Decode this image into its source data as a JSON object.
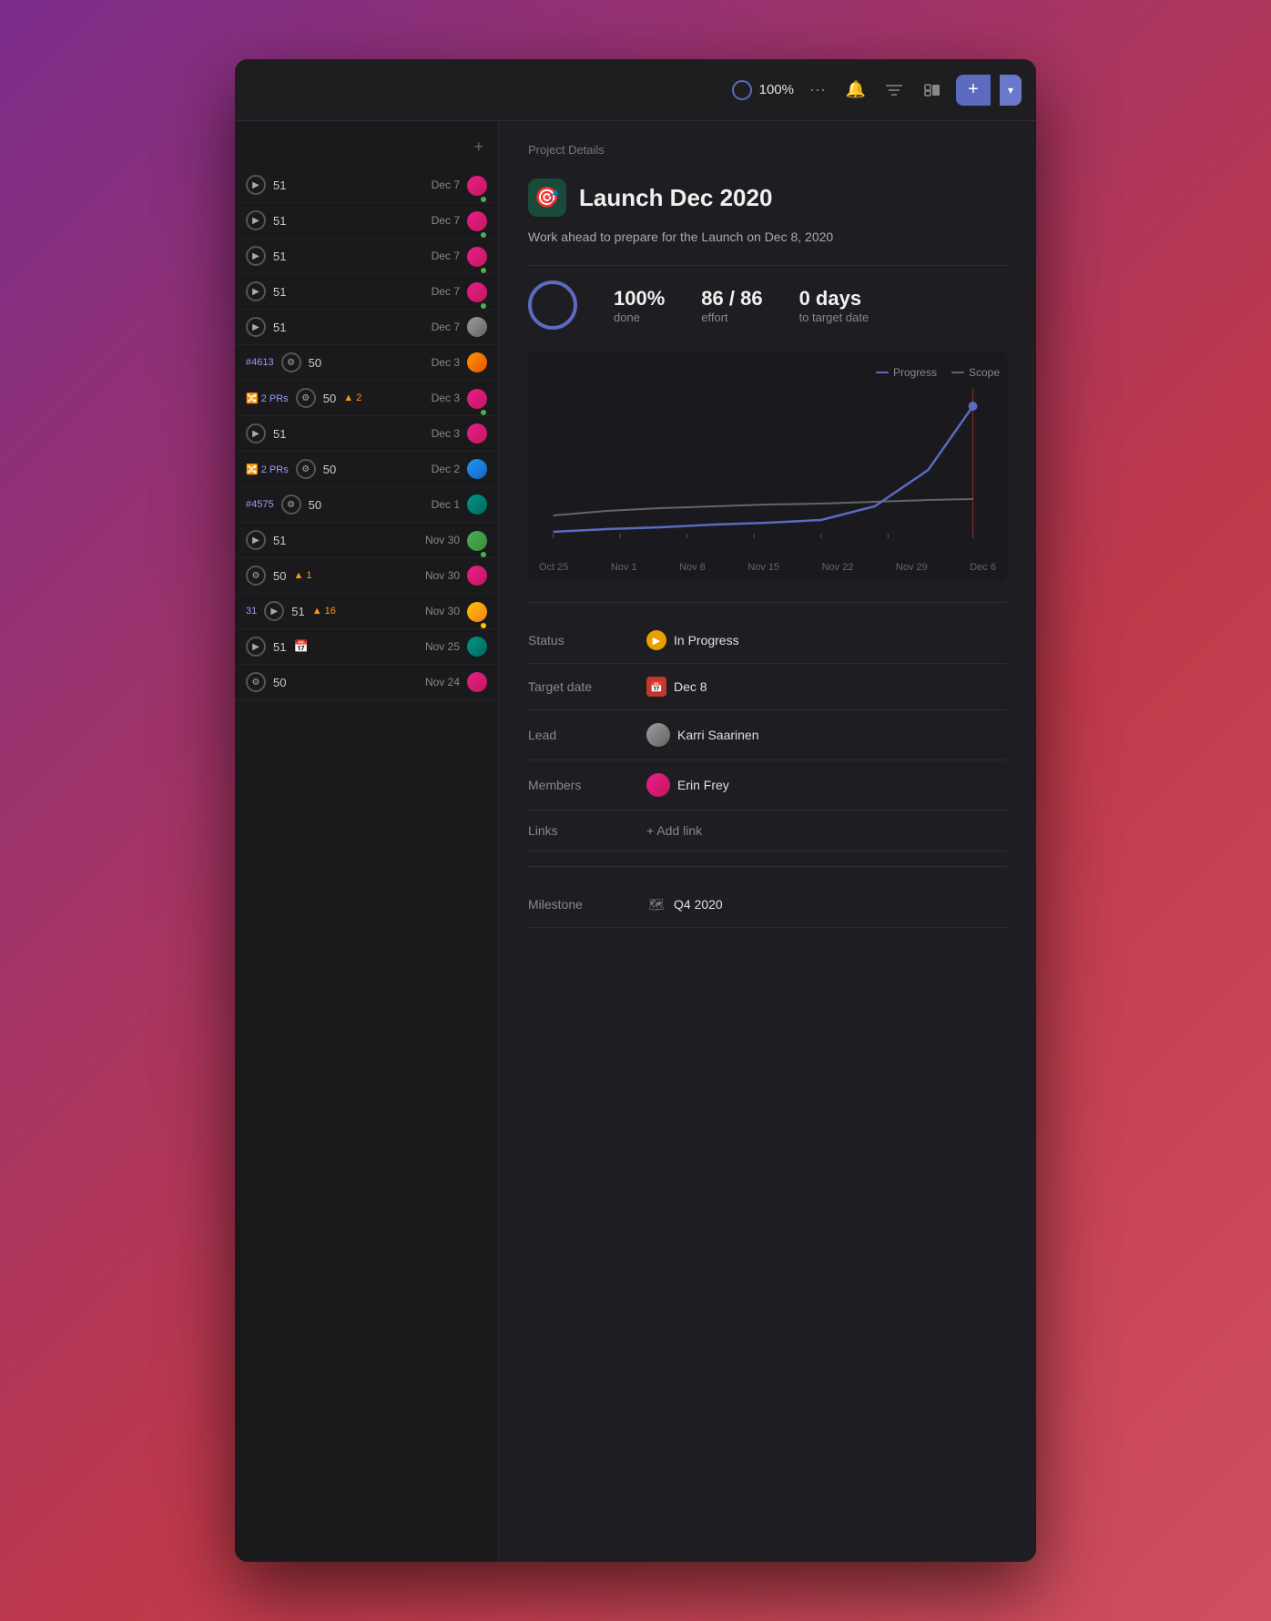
{
  "toolbar": {
    "progress_label": "100%",
    "add_label": "+",
    "chevron_label": "▾"
  },
  "sidebar": {
    "add_icon": "+",
    "items": [
      {
        "num": "51",
        "date": "Dec 7",
        "avatar": "av-pink",
        "dot": "green"
      },
      {
        "num": "51",
        "date": "Dec 7",
        "avatar": "av-pink",
        "dot": "green"
      },
      {
        "num": "51",
        "date": "Dec 7",
        "avatar": "av-pink",
        "dot": "green"
      },
      {
        "num": "51",
        "date": "Dec 7",
        "avatar": "av-pink",
        "dot": "green"
      },
      {
        "num": "51",
        "date": "Dec 7",
        "avatar": "av-gray",
        "dot": "none"
      },
      {
        "issue_id": "#4613",
        "num": "50",
        "date": "Dec 3",
        "avatar": "av-orange",
        "dot": "none"
      },
      {
        "pr_label": "2 PRs",
        "warning": "2",
        "num": "50",
        "date": "Dec 3",
        "avatar": "av-pink",
        "dot": "green"
      },
      {
        "num": "51",
        "date": "Dec 3",
        "avatar": "av-pink",
        "dot": "none"
      },
      {
        "pr_label": "2 PRs",
        "num": "50",
        "date": "Dec 2",
        "avatar": "av-blue",
        "dot": "none"
      },
      {
        "issue_id": "#4575",
        "num": "50",
        "date": "Dec 1",
        "avatar": "av-teal",
        "dot": "none"
      },
      {
        "num": "51",
        "date": "Nov 30",
        "avatar": "av-green",
        "dot": "green"
      },
      {
        "num": "50",
        "warning": "1",
        "date": "Nov 30",
        "avatar": "av-pink",
        "dot": "none"
      },
      {
        "issue_id": "31",
        "num": "51",
        "warning": "16",
        "date": "Nov 30",
        "avatar": "av-yellow",
        "dot": "none"
      },
      {
        "num": "51",
        "date": "Nov 25",
        "calendar": true,
        "avatar": "av-teal",
        "dot": "none"
      },
      {
        "num": "50",
        "date": "Nov 24",
        "avatar": "av-pink",
        "dot": "none"
      }
    ]
  },
  "detail": {
    "breadcrumb": "Project Details",
    "project_icon": "🎯",
    "project_title": "Launch Dec 2020",
    "project_description": "Work ahead to prepare for the Launch on Dec 8, 2020",
    "stats": {
      "done_percent": "100%",
      "done_label": "done",
      "effort_value": "86 / 86",
      "effort_label": "effort",
      "days_value": "0 days",
      "days_label": "to target date"
    },
    "chart": {
      "legend": {
        "progress_label": "Progress",
        "scope_label": "Scope"
      },
      "x_labels": [
        "Oct 25",
        "Nov 1",
        "Nov 8",
        "Nov 15",
        "Nov 22",
        "Nov 29",
        "Dec 6"
      ]
    },
    "status_label": "Status",
    "status_value": "In Progress",
    "target_date_label": "Target date",
    "target_date_value": "Dec 8",
    "lead_label": "Lead",
    "lead_value": "Karri Saarinen",
    "members_label": "Members",
    "members_value": "Erin Frey",
    "links_label": "Links",
    "links_value": "+ Add link",
    "milestone_label": "Milestone",
    "milestone_value": "Q4 2020"
  }
}
